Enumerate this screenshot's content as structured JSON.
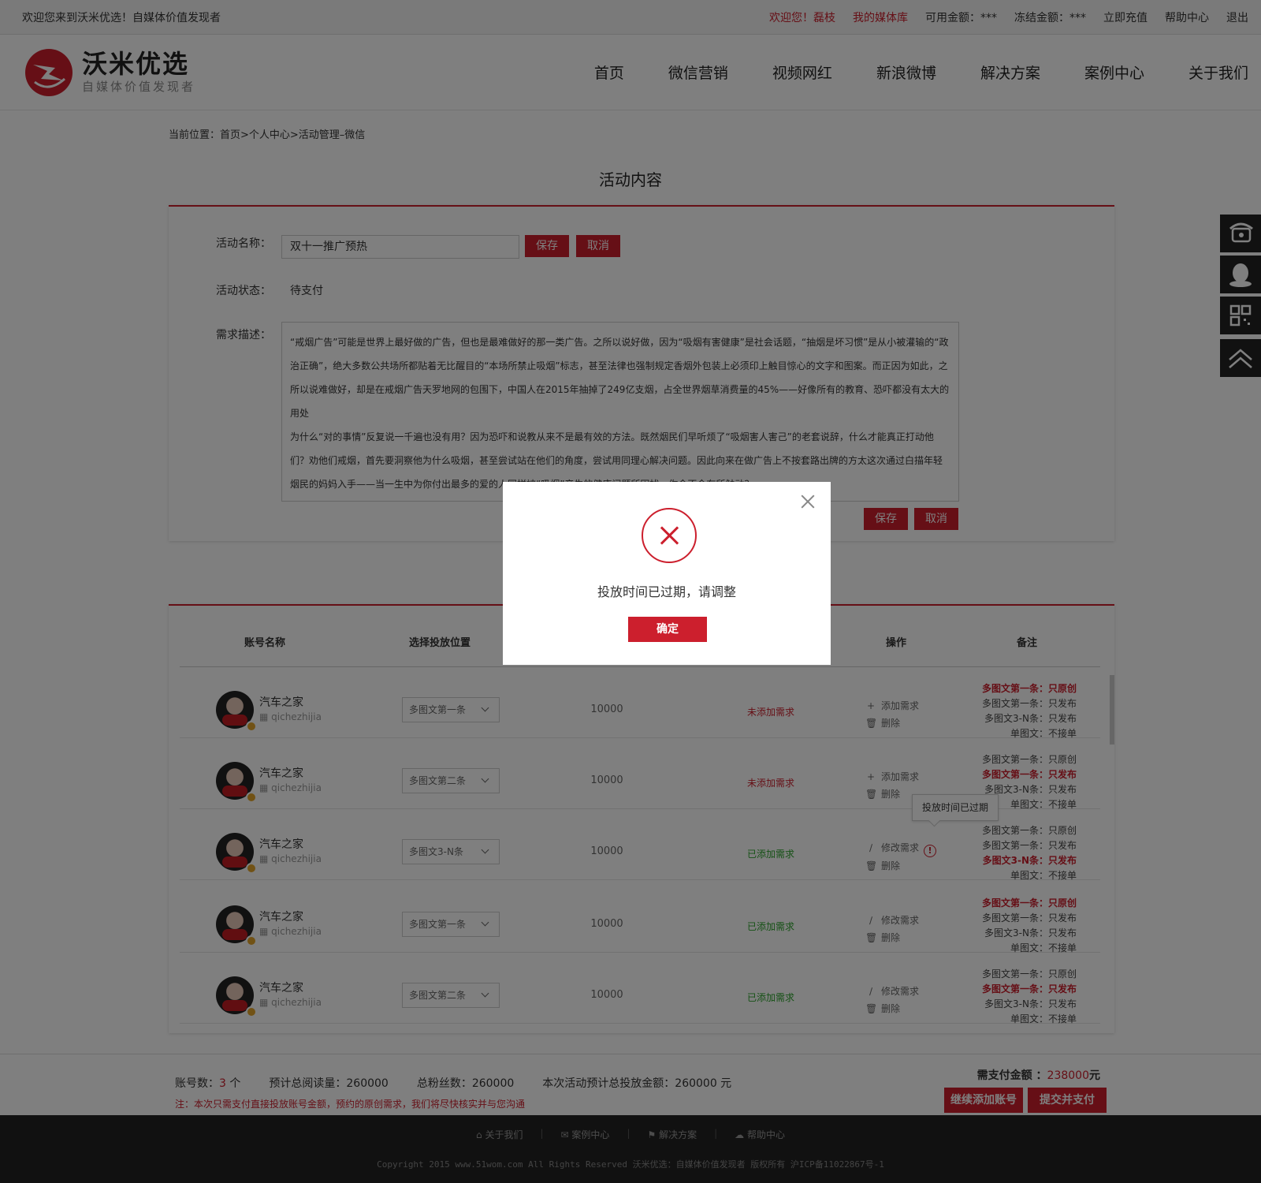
{
  "topbar": {
    "welcome": "欢迎您来到沃米优选！自媒体价值发现者",
    "greeting": "欢迎您！磊枝",
    "media_lib": "我的媒体库",
    "available": "可用金额：***",
    "frozen": "冻结金额：***",
    "recharge": "立即充值",
    "help": "帮助中心",
    "logout": "退出"
  },
  "logo": {
    "name": "沃米优选",
    "slogan": "自媒体价值发现者"
  },
  "nav": [
    "首页",
    "微信营销",
    "视频网红",
    "新浪微博",
    "解决方案",
    "案例中心",
    "关于我们"
  ],
  "breadcrumb": "当前位置：首页>个人中心>活动管理–微信",
  "page_title": "活动内容",
  "form": {
    "name_label": "活动名称：",
    "name_value": "双十一推广预热",
    "save": "保存",
    "cancel": "取消",
    "status_label": "活动状态：",
    "status_value": "待支付",
    "desc_label": "需求描述：",
    "desc_text": "“戒烟广告”可能是世界上最好做的广告，但也是最难做好的那一类广告。之所以说好做，因为“吸烟有害健康”是社会话题，“抽烟是坏习惯”是从小被灌输的“政治正确”，绝大多数公共场所都贴着无比醒目的“本场所禁止吸烟”标志，甚至法律也强制规定香烟外包装上必须印上触目惊心的文字和图案。而正因为如此，之所以说难做好，却是在戒烟广告天罗地网的包围下，中国人在2015年抽掉了249亿支烟，占全世界烟草消费量的45%——好像所有的教育、恐吓都没有太大的用处",
    "desc_text2": "为什么“对的事情”反复说一千遍也没有用？因为恐吓和说教从来不是最有效的方法。既然烟民们早听烦了“吸烟害人害己”的老套说辞，什么才能真正打动他们？劝他们戒烟，首先要洞察他为什么吸烟，甚至尝试站在他们的角度，尝试用同理心解决问题。因此向来在做广告上不按套路出牌的方太这次通过白描年轻烟民的妈妈入手——当一生中为你付出最多的爱的人同样被“吸烟”产生的健康问题所困扰，你会不会有所触动？"
  },
  "table": {
    "headers": [
      "账号名称",
      "选择投放位置",
      "操作",
      "备注"
    ],
    "rows": [
      {
        "name": "汽车之家",
        "id": "qichezhijia",
        "position": "多图文第一条",
        "reads": "10000",
        "status": "未添加需求",
        "status_type": "no",
        "op1": "添加需求",
        "op2": "删除",
        "op1_icon": "+",
        "warn": false,
        "notes": [
          {
            "t": "多图文第一条：只原创",
            "hl": true
          },
          {
            "t": "多图文第一条：只发布",
            "hl": false
          },
          {
            "t": "多图文3-N条：只发布",
            "hl": false
          },
          {
            "t": "单图文：不接单",
            "hl": false
          }
        ]
      },
      {
        "name": "汽车之家",
        "id": "qichezhijia",
        "position": "多图文第二条",
        "reads": "10000",
        "status": "未添加需求",
        "status_type": "no",
        "op1": "添加需求",
        "op2": "删除",
        "op1_icon": "+",
        "warn": false,
        "notes": [
          {
            "t": "多图文第一条：只原创",
            "hl": false
          },
          {
            "t": "多图文第一条：只发布",
            "hl": true
          },
          {
            "t": "多图文3-N条：只发布",
            "hl": false
          },
          {
            "t": "单图文：不接单",
            "hl": false
          }
        ]
      },
      {
        "name": "汽车之家",
        "id": "qichezhijia",
        "position": "多图文3-N条",
        "reads": "10000",
        "status": "已添加需求",
        "status_type": "yes",
        "op1": "修改需求",
        "op2": "删除",
        "op1_icon": "/",
        "warn": true,
        "notes": [
          {
            "t": "多图文第一条：只原创",
            "hl": false
          },
          {
            "t": "多图文第一条：只发布",
            "hl": false
          },
          {
            "t": "多图文3-N条：只发布",
            "hl": true
          },
          {
            "t": "单图文：不接单",
            "hl": false
          }
        ]
      },
      {
        "name": "汽车之家",
        "id": "qichezhijia",
        "position": "多图文第一条",
        "reads": "10000",
        "status": "已添加需求",
        "status_type": "yes",
        "op1": "修改需求",
        "op2": "删除",
        "op1_icon": "/",
        "warn": false,
        "notes": [
          {
            "t": "多图文第一条：只原创",
            "hl": true
          },
          {
            "t": "多图文第一条：只发布",
            "hl": false
          },
          {
            "t": "多图文3-N条：只发布",
            "hl": false
          },
          {
            "t": "单图文：不接单",
            "hl": false
          }
        ]
      },
      {
        "name": "汽车之家",
        "id": "qichezhijia",
        "position": "多图文第二条",
        "reads": "10000",
        "status": "已添加需求",
        "status_type": "yes",
        "op1": "修改需求",
        "op2": "删除",
        "op1_icon": "/",
        "warn": false,
        "notes": [
          {
            "t": "多图文第一条：只原创",
            "hl": false
          },
          {
            "t": "多图文第一条：只发布",
            "hl": true
          },
          {
            "t": "多图文3-N条：只发布",
            "hl": false
          },
          {
            "t": "单图文：不接单",
            "hl": false
          }
        ]
      }
    ],
    "tooltip": "投放时间已过期"
  },
  "summary": {
    "accounts_label": "账号数：",
    "accounts_value": "3",
    "accounts_unit": "个",
    "reads": "预计总阅读量：260000",
    "fans": "总粉丝数：260000",
    "total": "本次活动预计总投放金额：260000 元",
    "note": "注：本次只需支付直接投放账号金额，预约的原创需求，我们将尽快核实并与您沟通",
    "pay_label": "需支付金额 ：",
    "pay_amount": "238000",
    "pay_unit": "元",
    "continue_btn": "继续添加账号",
    "submit_btn": "提交并支付"
  },
  "footer": {
    "links": [
      "关于我们",
      "案例中心",
      "解决方案",
      "帮助中心"
    ],
    "copyright": "Copyright 2015 www.51wom.com All Rights Reserved 沃米优选：自媒体价值发现者 版权所有 沪ICP备11022867号-1"
  },
  "modal": {
    "message": "投放时间已过期，请调整",
    "ok": "确定"
  },
  "colors": {
    "brand": "#cc1f2d",
    "success": "#2aa32a"
  }
}
